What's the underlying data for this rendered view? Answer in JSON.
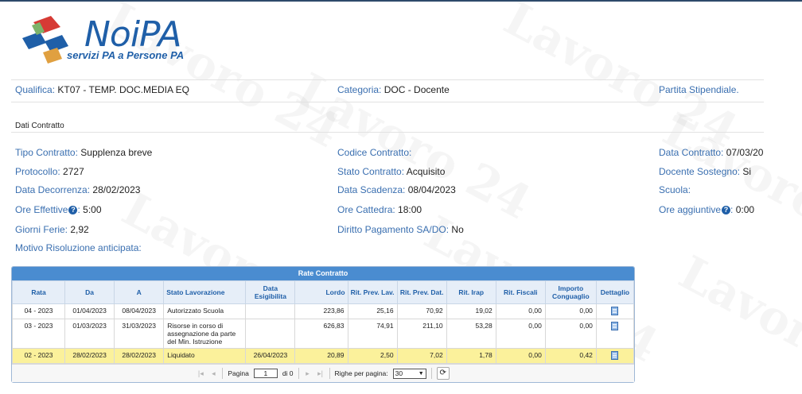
{
  "logo": {
    "word": "NoiPA",
    "subtitle": "servizi PA a Persone PA"
  },
  "header_row": {
    "qualifica_label": "Qualifica:",
    "qualifica_value": "KT07 - TEMP. DOC.MEDIA EQ",
    "categoria_label": "Categoria:",
    "categoria_value": "DOC - Docente",
    "partita_label": "Partita Stipendiale."
  },
  "section": {
    "title": "Dati Contratto"
  },
  "contract": {
    "tipo_label": "Tipo Contratto:",
    "tipo_value": "Supplenza breve",
    "codice_label": "Codice Contratto:",
    "codice_value": "",
    "data_contratto_label": "Data Contratto:",
    "data_contratto_value": "07/03/2023",
    "protocollo_label": "Protocollo:",
    "protocollo_value": "2727",
    "stato_label": "Stato Contratto:",
    "stato_value": "Acquisito",
    "sostegno_label": "Docente Sostegno:",
    "sostegno_value": "Si",
    "decorrenza_label": "Data Decorrenza:",
    "decorrenza_value": "28/02/2023",
    "scadenza_label": "Data Scadenza:",
    "scadenza_value": "08/04/2023",
    "scuola_label": "Scuola:",
    "scuola_value": "",
    "ore_eff_label": "Ore Effettive",
    "ore_eff_value": "5:00",
    "ore_catt_label": "Ore Cattedra:",
    "ore_catt_value": "18:00",
    "ore_agg_label": "Ore aggiuntive",
    "ore_agg_value": "0:00",
    "giorni_label": "Giorni Ferie:",
    "giorni_value": "2,92",
    "diritto_label": "Diritto Pagamento SA/DO:",
    "diritto_value": "No",
    "motivo_label": "Motivo Risoluzione anticipata:",
    "help_glyph": "?",
    "colon": ":"
  },
  "grid": {
    "caption": "Rate Contratto",
    "columns": [
      "Rata",
      "Da",
      "A",
      "Stato Lavorazione",
      "Data Esigibilita",
      "Lordo",
      "Rit. Prev. Lav.",
      "Rit. Prev. Dat.",
      "Rit. Irap",
      "Rit. Fiscali",
      "Importo Conguaglio",
      "Dettaglio"
    ],
    "rows": [
      {
        "rata": "04 - 2023",
        "da": "01/04/2023",
        "a": "08/04/2023",
        "stato": "Autorizzato Scuola",
        "esig": "",
        "lordo": "223,86",
        "prev_lav": "25,16",
        "prev_dat": "70,92",
        "irap": "19,02",
        "fiscali": "0,00",
        "cong": "0,00"
      },
      {
        "rata": "03 - 2023",
        "da": "01/03/2023",
        "a": "31/03/2023",
        "stato": "Risorse in corso di assegnazione da parte del Min. Istruzione",
        "esig": "",
        "lordo": "626,83",
        "prev_lav": "74,91",
        "prev_dat": "211,10",
        "irap": "53,28",
        "fiscali": "0,00",
        "cong": "0,00"
      },
      {
        "rata": "02 - 2023",
        "da": "28/02/2023",
        "a": "28/02/2023",
        "stato": "Liquidato",
        "esig": "26/04/2023",
        "lordo": "20,89",
        "prev_lav": "2,50",
        "prev_dat": "7,02",
        "irap": "1,78",
        "fiscali": "0,00",
        "cong": "0,42"
      }
    ],
    "pager": {
      "page_label": "Pagina",
      "page_value": "1",
      "of_label": "di 0",
      "rows_label": "Righe per pagina:",
      "rows_value": "30"
    }
  },
  "colors": {
    "label": "#3a6fb0",
    "grid_header": "#4a8cd0",
    "highlight_row": "#fbf19b",
    "logo": "#1f5fa8"
  }
}
